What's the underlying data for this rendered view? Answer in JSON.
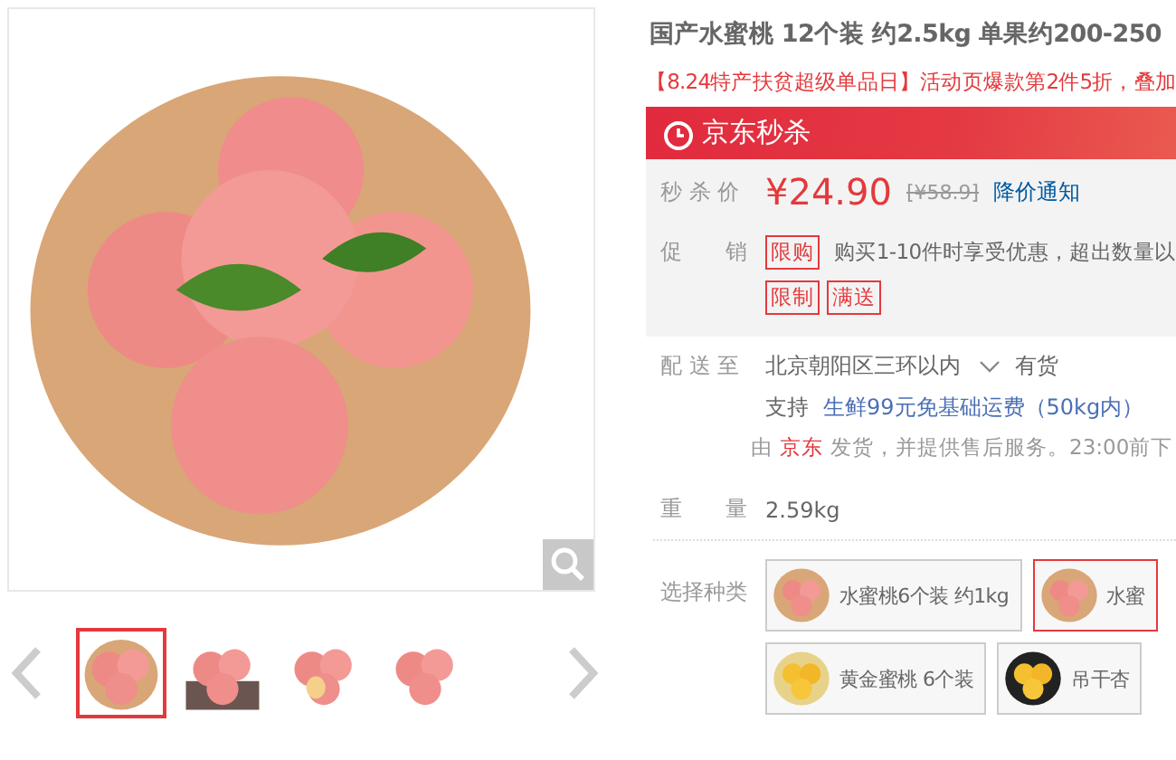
{
  "gallery": {
    "thumbnails": [
      {
        "selected": true
      },
      {
        "selected": false
      },
      {
        "selected": false
      },
      {
        "selected": false
      }
    ]
  },
  "product": {
    "title": "国产水蜜桃 12个装 约2.5kg 单果约200-250",
    "promo_line": "【8.24特产扶贫超级单品日】活动页爆款第2件5折，叠加",
    "flash_sale_banner": "京东秒杀",
    "price": {
      "label": "秒 杀 价",
      "value": "¥24.90",
      "original": "[¥58.9]",
      "notify_link": "降价通知"
    },
    "promotions": {
      "label": "促　　销",
      "items": [
        {
          "tag": "限购",
          "text": "购买1-10件时享受优惠，超出数量以"
        }
      ],
      "tags": [
        "限制",
        "满送"
      ]
    },
    "delivery": {
      "label": "配 送 至",
      "address": "北京朝阳区三环以内",
      "stock": "有货",
      "support_label": "支持",
      "support_text": "生鲜99元免基础运费（50kg内）",
      "ship_prefix": "由",
      "ship_seller": "京东",
      "ship_text": "发货，并提供售后服务。23:00前下"
    },
    "weight": {
      "label": "重　　量",
      "value": "2.59kg"
    },
    "variants": {
      "label": "选择种类",
      "options": [
        {
          "name": "水蜜桃6个装 约1kg",
          "selected": false
        },
        {
          "name": "水蜜",
          "selected": true
        },
        {
          "name": "黄金蜜桃 6个装",
          "selected": false
        },
        {
          "name": "吊干杏",
          "selected": false
        }
      ]
    }
  }
}
